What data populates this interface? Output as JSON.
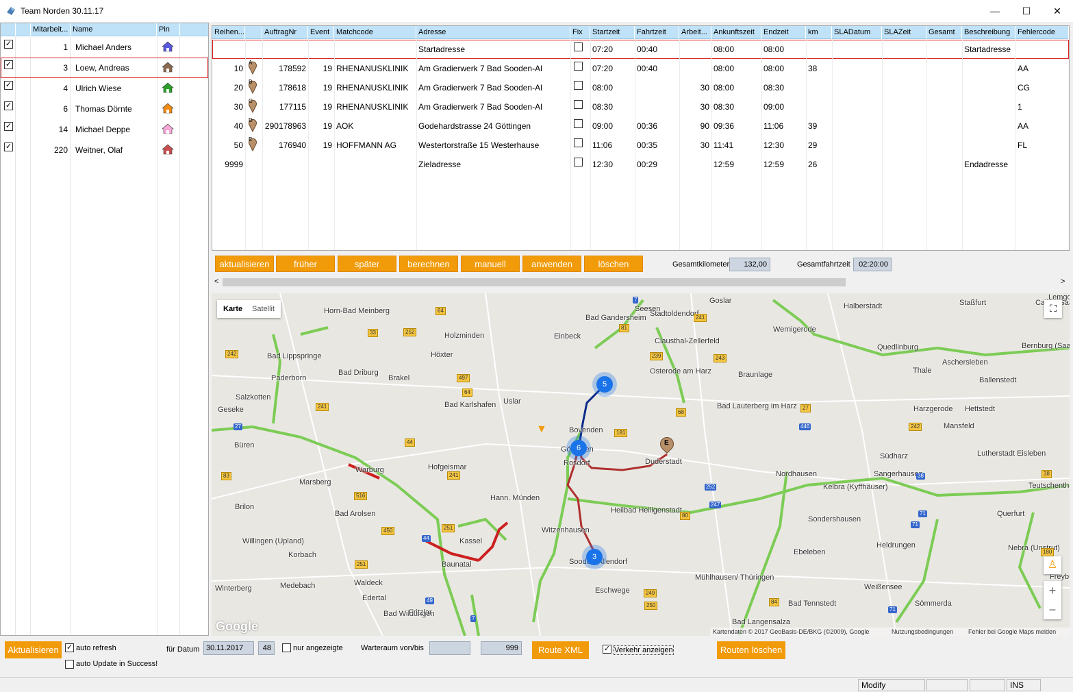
{
  "window": {
    "title": "Team Norden 30.11.17",
    "min": "—",
    "max": "☐",
    "close": "✕"
  },
  "employees": {
    "headers": [
      "Mitarbeit...",
      "Name",
      "Pin"
    ],
    "rows": [
      {
        "checked": "✓",
        "num": "1",
        "name": "Michael Anders",
        "pin_color": "#5a5adc"
      },
      {
        "checked": "✓",
        "num": "3",
        "name": "Loew, Andreas",
        "pin_color": "#8a6a50"
      },
      {
        "checked": "✓",
        "num": "4",
        "name": "Ulrich Wiese",
        "pin_color": "#2aa02a"
      },
      {
        "checked": "✓",
        "num": "6",
        "name": "Thomas Dörnte",
        "pin_color": "#f08a10"
      },
      {
        "checked": "✓",
        "num": "14",
        "name": "Michael Deppe",
        "pin_color": "#f7a6d8"
      },
      {
        "checked": "✓",
        "num": "220",
        "name": "Weitner, Olaf",
        "pin_color": "#c85050"
      }
    ]
  },
  "grid": {
    "headers": [
      "Reihen...",
      "",
      "AuftragNr",
      "Event",
      "Matchcode",
      "Adresse",
      "Fix",
      "Startzeit",
      "Fahrtzeit",
      "Arbeit...",
      "Ankunftszeit",
      "Endzeit",
      "km",
      "SLADatum",
      "SLAZeit",
      "Gesamt",
      "Beschreibung",
      "Fehlercode"
    ],
    "rows": [
      {
        "reihe": "",
        "marker": "",
        "auftrag": "",
        "event": "",
        "match": "",
        "adresse": "Startadresse",
        "start": "07:20",
        "fahrt": "00:40",
        "arbeit": "",
        "ankunft": "08:00",
        "ende": "08:00",
        "km": "",
        "beschr": "Startadresse",
        "fehler": ""
      },
      {
        "reihe": "10",
        "marker": "A",
        "auftrag": "178592",
        "event": "19",
        "match": "RHENANUSKLINIK",
        "adresse": "Am Gradierwerk 7 Bad Sooden-Al",
        "start": "07:20",
        "fahrt": "00:40",
        "arbeit": "",
        "ankunft": "08:00",
        "ende": "08:00",
        "km": "38",
        "beschr": "",
        "fehler": "AA"
      },
      {
        "reihe": "20",
        "marker": "B",
        "auftrag": "178618",
        "event": "19",
        "match": "RHENANUSKLINIK",
        "adresse": "Am Gradierwerk 7 Bad Sooden-Al",
        "start": "08:00",
        "fahrt": "",
        "arbeit": "30",
        "ankunft": "08:00",
        "ende": "08:30",
        "km": "",
        "beschr": "",
        "fehler": "CG"
      },
      {
        "reihe": "30",
        "marker": "C",
        "auftrag": "177115",
        "event": "19",
        "match": "RHENANUSKLINIK",
        "adresse": "Am Gradierwerk 7 Bad Sooden-Al",
        "start": "08:30",
        "fahrt": "",
        "arbeit": "30",
        "ankunft": "08:30",
        "ende": "09:00",
        "km": "",
        "beschr": "",
        "fehler": "1"
      },
      {
        "reihe": "40",
        "marker": "D",
        "auftrag": "290178963",
        "event": "19",
        "match": "AOK",
        "adresse": "Godehardstrasse 24 Göttingen",
        "start": "09:00",
        "fahrt": "00:36",
        "arbeit": "90",
        "ankunft": "09:36",
        "ende": "11:06",
        "km": "39",
        "beschr": "",
        "fehler": "AA"
      },
      {
        "reihe": "50",
        "marker": "E",
        "auftrag": "176940",
        "event": "19",
        "match": "HOFFMANN AG",
        "adresse": "Westertorstraße 15 Westerhause",
        "start": "11:06",
        "fahrt": "00:35",
        "arbeit": "30",
        "ankunft": "11:41",
        "ende": "12:30",
        "km": "29",
        "beschr": "",
        "fehler": "FL"
      },
      {
        "reihe": "9999",
        "marker": "",
        "auftrag": "",
        "event": "",
        "match": "",
        "adresse": "Zieladresse",
        "start": "12:30",
        "fahrt": "00:29",
        "arbeit": "",
        "ankunft": "12:59",
        "ende": "12:59",
        "km": "26",
        "beschr": "Endadresse",
        "fehler": ""
      }
    ]
  },
  "toolbar": {
    "buttons": [
      "aktualisieren",
      "früher",
      "später",
      "berechnen",
      "manuell",
      "anwenden",
      "löschen"
    ],
    "gesamtkm_label": "Gesamtkilometer",
    "gesamtkm_value": "132,00",
    "gesamtfahrt_label": "Gesamtfahrtzeit",
    "gesamtfahrt_value": "02:20:00"
  },
  "map": {
    "tab_karte": "Karte",
    "tab_satellit": "Satellit",
    "google": "Google",
    "attribution": "Kartendaten © 2017 GeoBasis-DE/BKG (©2009), Google",
    "terms": "Nutzungsbedingungen",
    "report": "Fehler bei Google Maps melden",
    "cluster1": "5",
    "cluster2": "6",
    "cluster3": "3",
    "marker_e": "E",
    "zoom_in": "+",
    "zoom_out": "−",
    "places": [
      "Goslar",
      "Halberstadt",
      "Stadtoldendorf",
      "Bad Gandersheim",
      "Seesen",
      "Horn-Bad Meinberg",
      "Holzminden",
      "Einbeck",
      "Clausthal-Zellerfeld",
      "Wernigerode",
      "Quedlinburg",
      "Bad Lippspringe",
      "Höxter",
      "Osterode am Harz",
      "Thale",
      "Aschersleben",
      "Bernburg (Saale)",
      "Paderborn",
      "Bad Driburg",
      "Brakel",
      "Braunlage",
      "Ballenstedt",
      "Salzkotten",
      "Geseke",
      "Uslar",
      "Bad Karlshafen",
      "Bad Lauterberg im Harz",
      "Harzgerode",
      "Hettstedt",
      "Bovenden",
      "Mansfeld",
      "Büren",
      "Göttingen",
      "Rosdorf",
      "Duderstadt",
      "Südharz",
      "Lutherstadt Eisleben",
      "Warburg",
      "Hofgeismar",
      "Nordhausen",
      "Sangerhausen",
      "Marsberg",
      "Hann. Münden",
      "Kelbra (Kyffhäuser)",
      "Teutschenthal",
      "Brilon",
      "Bad Arolsen",
      "Heilbad Heiligenstadt",
      "Sondershausen",
      "Querfurt",
      "Witzenhausen",
      "Willingen (Upland)",
      "Kassel",
      "Heldrungen",
      "Nebra (Unstrut)",
      "Korbach",
      "Baunatal",
      "Sooden-Allendorf",
      "Ebeleben",
      "Winterberg",
      "Medebach",
      "Waldeck",
      "Mühlhausen/ Thüringen",
      "Freyburg (Un",
      "Eschwege",
      "Weißensee",
      "Edertal",
      "Bad Tennstedt",
      "Sömmerda",
      "Bad Wildungen",
      "Fritzlar",
      "Bad Langensalza",
      "Staßfurt",
      "Calbe (Saale)",
      "Lemgo"
    ],
    "roads": [
      "7",
      "241",
      "81",
      "64",
      "33",
      "252",
      "239",
      "243",
      "242",
      "497",
      "64",
      "241",
      "68",
      "27",
      "181",
      "242",
      "446",
      "27",
      "44",
      "241",
      "83",
      "516",
      "252",
      "38",
      "80",
      "247",
      "38",
      "71",
      "450",
      "251",
      "44",
      "71",
      "251",
      "49",
      "249",
      "250",
      "84",
      "71",
      "180",
      "7"
    ]
  },
  "bottom": {
    "aktualisieren": "Aktualisieren",
    "auto_refresh": "auto refresh",
    "auto_refresh_checked": "✓",
    "auto_update": "auto Update in Success!",
    "auto_update_checked": "",
    "fuer_datum": "für Datum",
    "datum": "30.11.2017",
    "week": "48",
    "nur_angezeigte": "nur angezeigte",
    "warteraum": "Warteraum von/bis",
    "warteraum_von": "",
    "warteraum_bis": "999",
    "route_xml": "Route XML",
    "verkehr": "Verkehr anzeigen",
    "verkehr_checked": "✓",
    "routen_loeschen": "Routen löschen"
  },
  "status": {
    "mode": "Modify",
    "ins": "INS"
  },
  "colors": {
    "accent": "#f29b0a",
    "header": "#bfe2f8",
    "selection": "#d22222"
  }
}
